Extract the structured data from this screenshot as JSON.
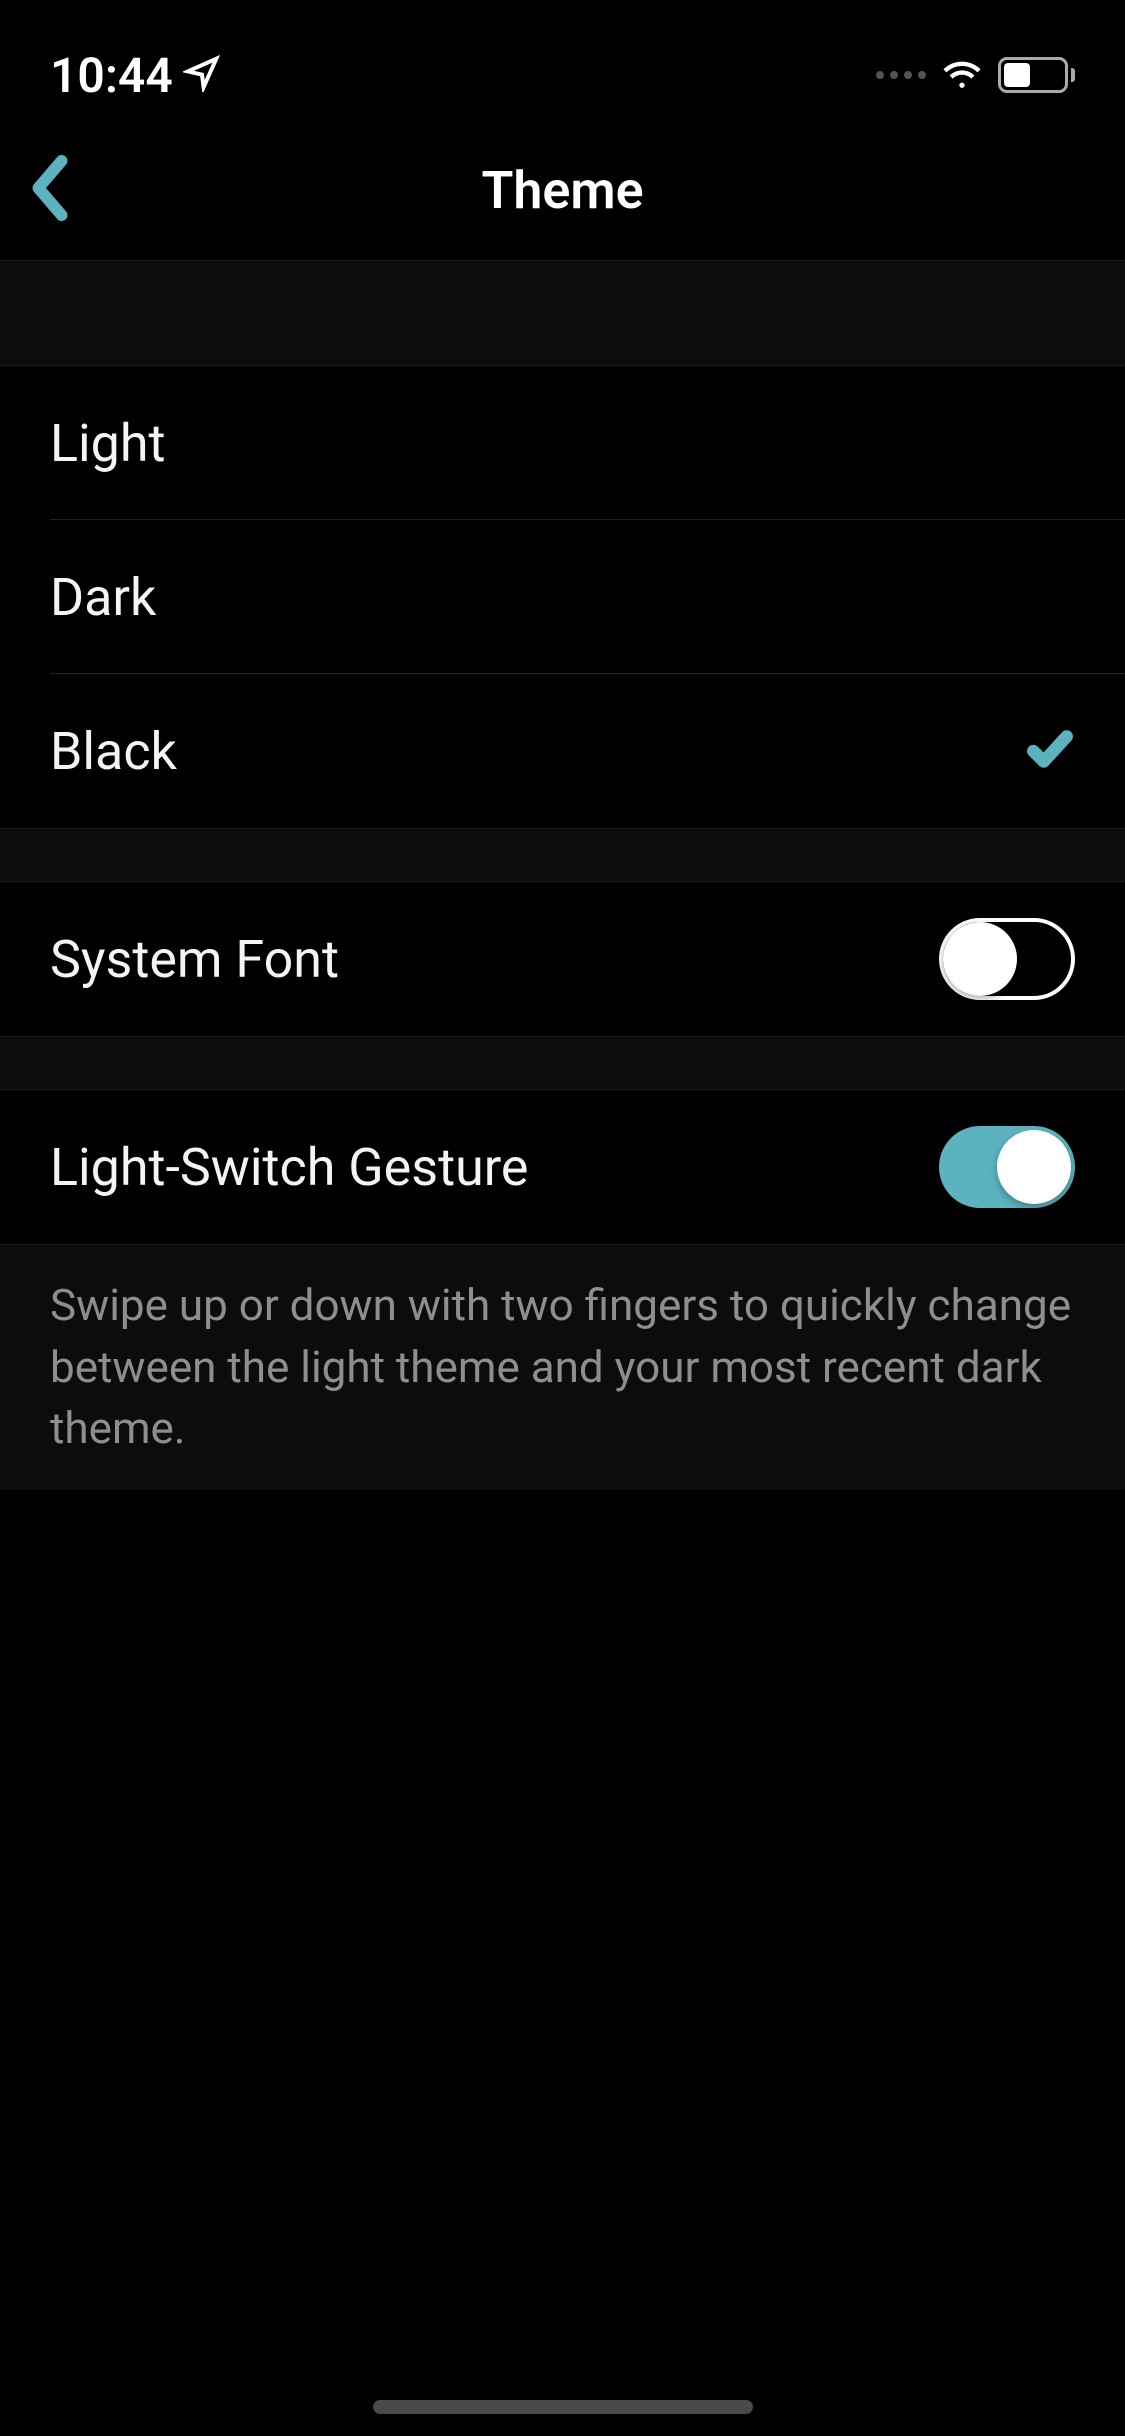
{
  "status_bar": {
    "time": "10:44"
  },
  "nav": {
    "title": "Theme"
  },
  "theme_options": [
    {
      "label": "Light",
      "selected": false
    },
    {
      "label": "Dark",
      "selected": false
    },
    {
      "label": "Black",
      "selected": true
    }
  ],
  "system_font": {
    "label": "System Font",
    "enabled": false
  },
  "light_switch": {
    "label": "Light-Switch Gesture",
    "enabled": true,
    "footer": "Swipe up or down with two fingers to quickly change between the light theme and your most recent dark theme."
  },
  "colors": {
    "accent": "#5cb3bf"
  }
}
